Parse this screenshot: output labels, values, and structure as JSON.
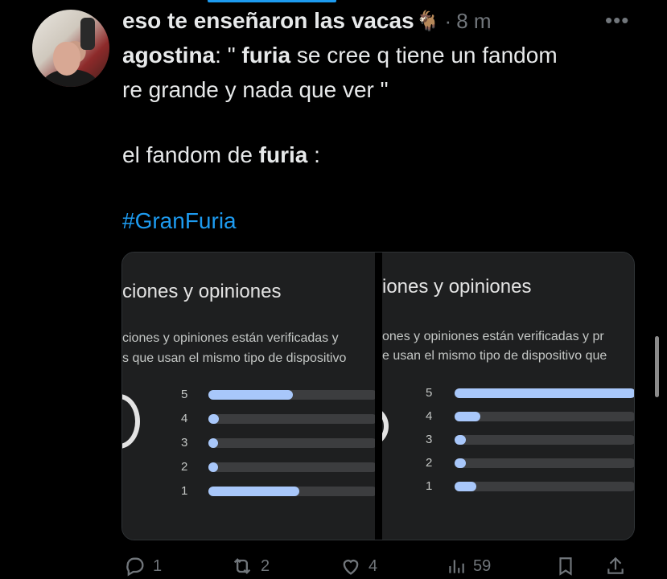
{
  "tweet": {
    "display_name": "eso te enseñaron las vacas",
    "emoji": "🐐",
    "separator": "·",
    "time": "8 m",
    "more": "•••",
    "line1": {
      "name": "agostina",
      "p1": ": \" ",
      "b1": "furia",
      "p2": " se cree q tiene un fandom"
    },
    "line2": "re grande y nada que ver \"",
    "line3": {
      "p1": "el fandom de ",
      "b1": "furia",
      "p2": " :"
    },
    "hashtag": "#GranFuria"
  },
  "media": {
    "left": {
      "title": "ciones y opiniones",
      "desc1": "ciones y opiniones están verificadas y",
      "desc2": "s que usan el mismo tipo de dispositivo",
      "ratings": [
        {
          "label": "5",
          "fraction": 0.5
        },
        {
          "label": "4",
          "fraction": 0.06
        },
        {
          "label": "3",
          "fraction": 0.05
        },
        {
          "label": "2",
          "fraction": 0.05
        },
        {
          "label": "1",
          "fraction": 0.54
        }
      ]
    },
    "right": {
      "title": "iones y opiniones",
      "desc1": "ones y opiniones están verificadas y pr",
      "desc2": "e usan el mismo tipo de dispositivo que",
      "ratings": [
        {
          "label": "5",
          "fraction": 1.0
        },
        {
          "label": "4",
          "fraction": 0.14
        },
        {
          "label": "3",
          "fraction": 0.06
        },
        {
          "label": "2",
          "fraction": 0.06
        },
        {
          "label": "1",
          "fraction": 0.12
        }
      ]
    }
  },
  "actions": {
    "replies": "1",
    "reposts": "2",
    "likes": "4",
    "views": "59"
  },
  "colors": {
    "accent": "#1d9bf0",
    "bar_fill": "#a8c7fa",
    "bar_track": "#3c3d3f"
  }
}
